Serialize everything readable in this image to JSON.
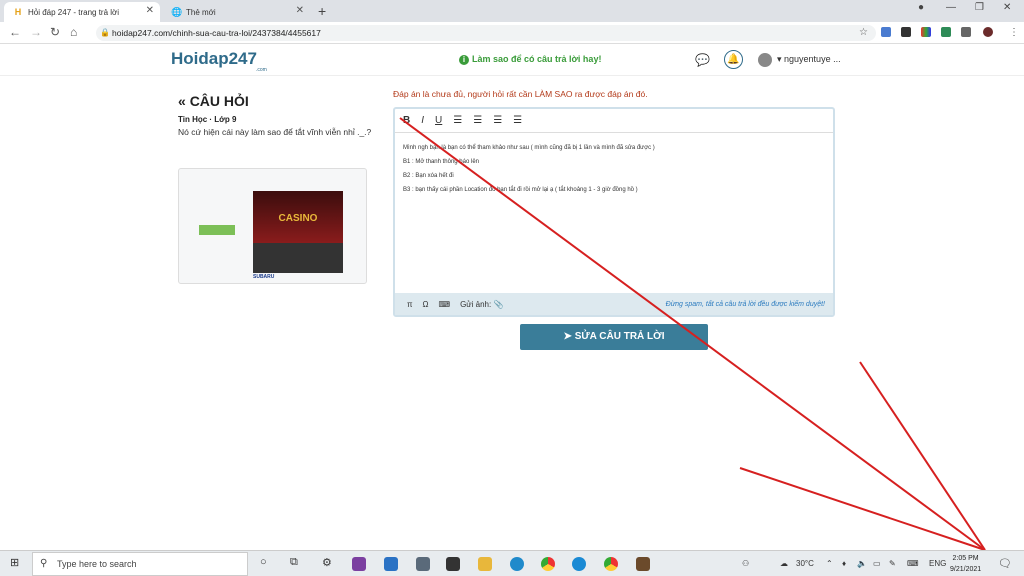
{
  "browser": {
    "tabs": [
      {
        "title": "Hỏi đáp 247 - trang trả lời",
        "active": true
      },
      {
        "title": "Thẻ mới",
        "active": false
      }
    ],
    "url": "hoidap247.com/chinh-sua-cau-tra-loi/2437384/4455617"
  },
  "site": {
    "logo": "Hoidap247",
    "logo_sub": ".com",
    "promo": "Làm sao để có câu trả lời hay!",
    "username": "nguyentuye ..."
  },
  "question": {
    "heading": "CÂU HỎI",
    "meta": "Tin Học · Lớp 9",
    "text": "Nó cứ hiện cái này làm sao để tắt vĩnh viễn nhỉ ._.?",
    "ad_casino": "CASINO",
    "ad_brand": "SUBARU"
  },
  "editor": {
    "notice": "Đáp án là chưa đủ, người hỏi rất cần LÀM SAO ra được đáp án đó.",
    "lines": [
      "Mình ngh bạn là bạn có thể tham khảo như sau ( mình cũng đã bị 1 lần và mình đã sửa được )",
      "B1 : Mở thanh thông báo lên",
      "B2 : Bạn xóa hết đi",
      "B3 : bạn thấy cái phần Location đó bạn tắt đi rồi mở lại ạ ( tắt khoảng 1 - 3 giờ đồng hồ )"
    ],
    "upload_label": "Gửi ảnh:",
    "warning": "Đừng spam, tất cả câu trả lời đều được kiểm duyệt!",
    "submit": "SỬA CÂU TRẢ LỜI"
  },
  "taskbar": {
    "search_placeholder": "Type here to search",
    "temperature": "30°C",
    "lang": "ENG",
    "time": "2:05 PM",
    "date": "9/21/2021"
  }
}
